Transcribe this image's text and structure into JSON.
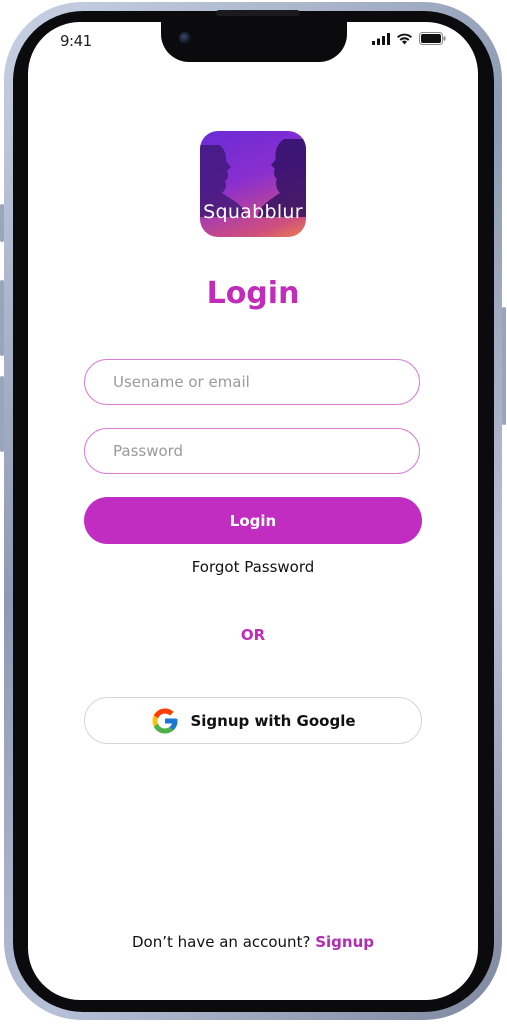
{
  "status_bar": {
    "time": "9:41",
    "icons": [
      "cellular-signal-icon",
      "wifi-icon",
      "battery-icon"
    ]
  },
  "app": {
    "logo_text": "Squabblur",
    "logo_icon": "two-faced-silhouettes-icon"
  },
  "login": {
    "title": "Login",
    "username_placeholder": "Usename or email",
    "username_value": "",
    "password_placeholder": "Password",
    "password_value": "",
    "login_button": "Login",
    "forgot_password": "Forgot Password",
    "divider": "OR",
    "google_button": "Signup with Google",
    "google_icon": "google-g-icon",
    "no_account_text": "Don’t have an account?",
    "signup_link": "Signup"
  },
  "colors": {
    "brand": "#c12cbb",
    "button": "#c02dc0",
    "input_border": "#d97fd3",
    "signup_link": "#b02db4"
  }
}
